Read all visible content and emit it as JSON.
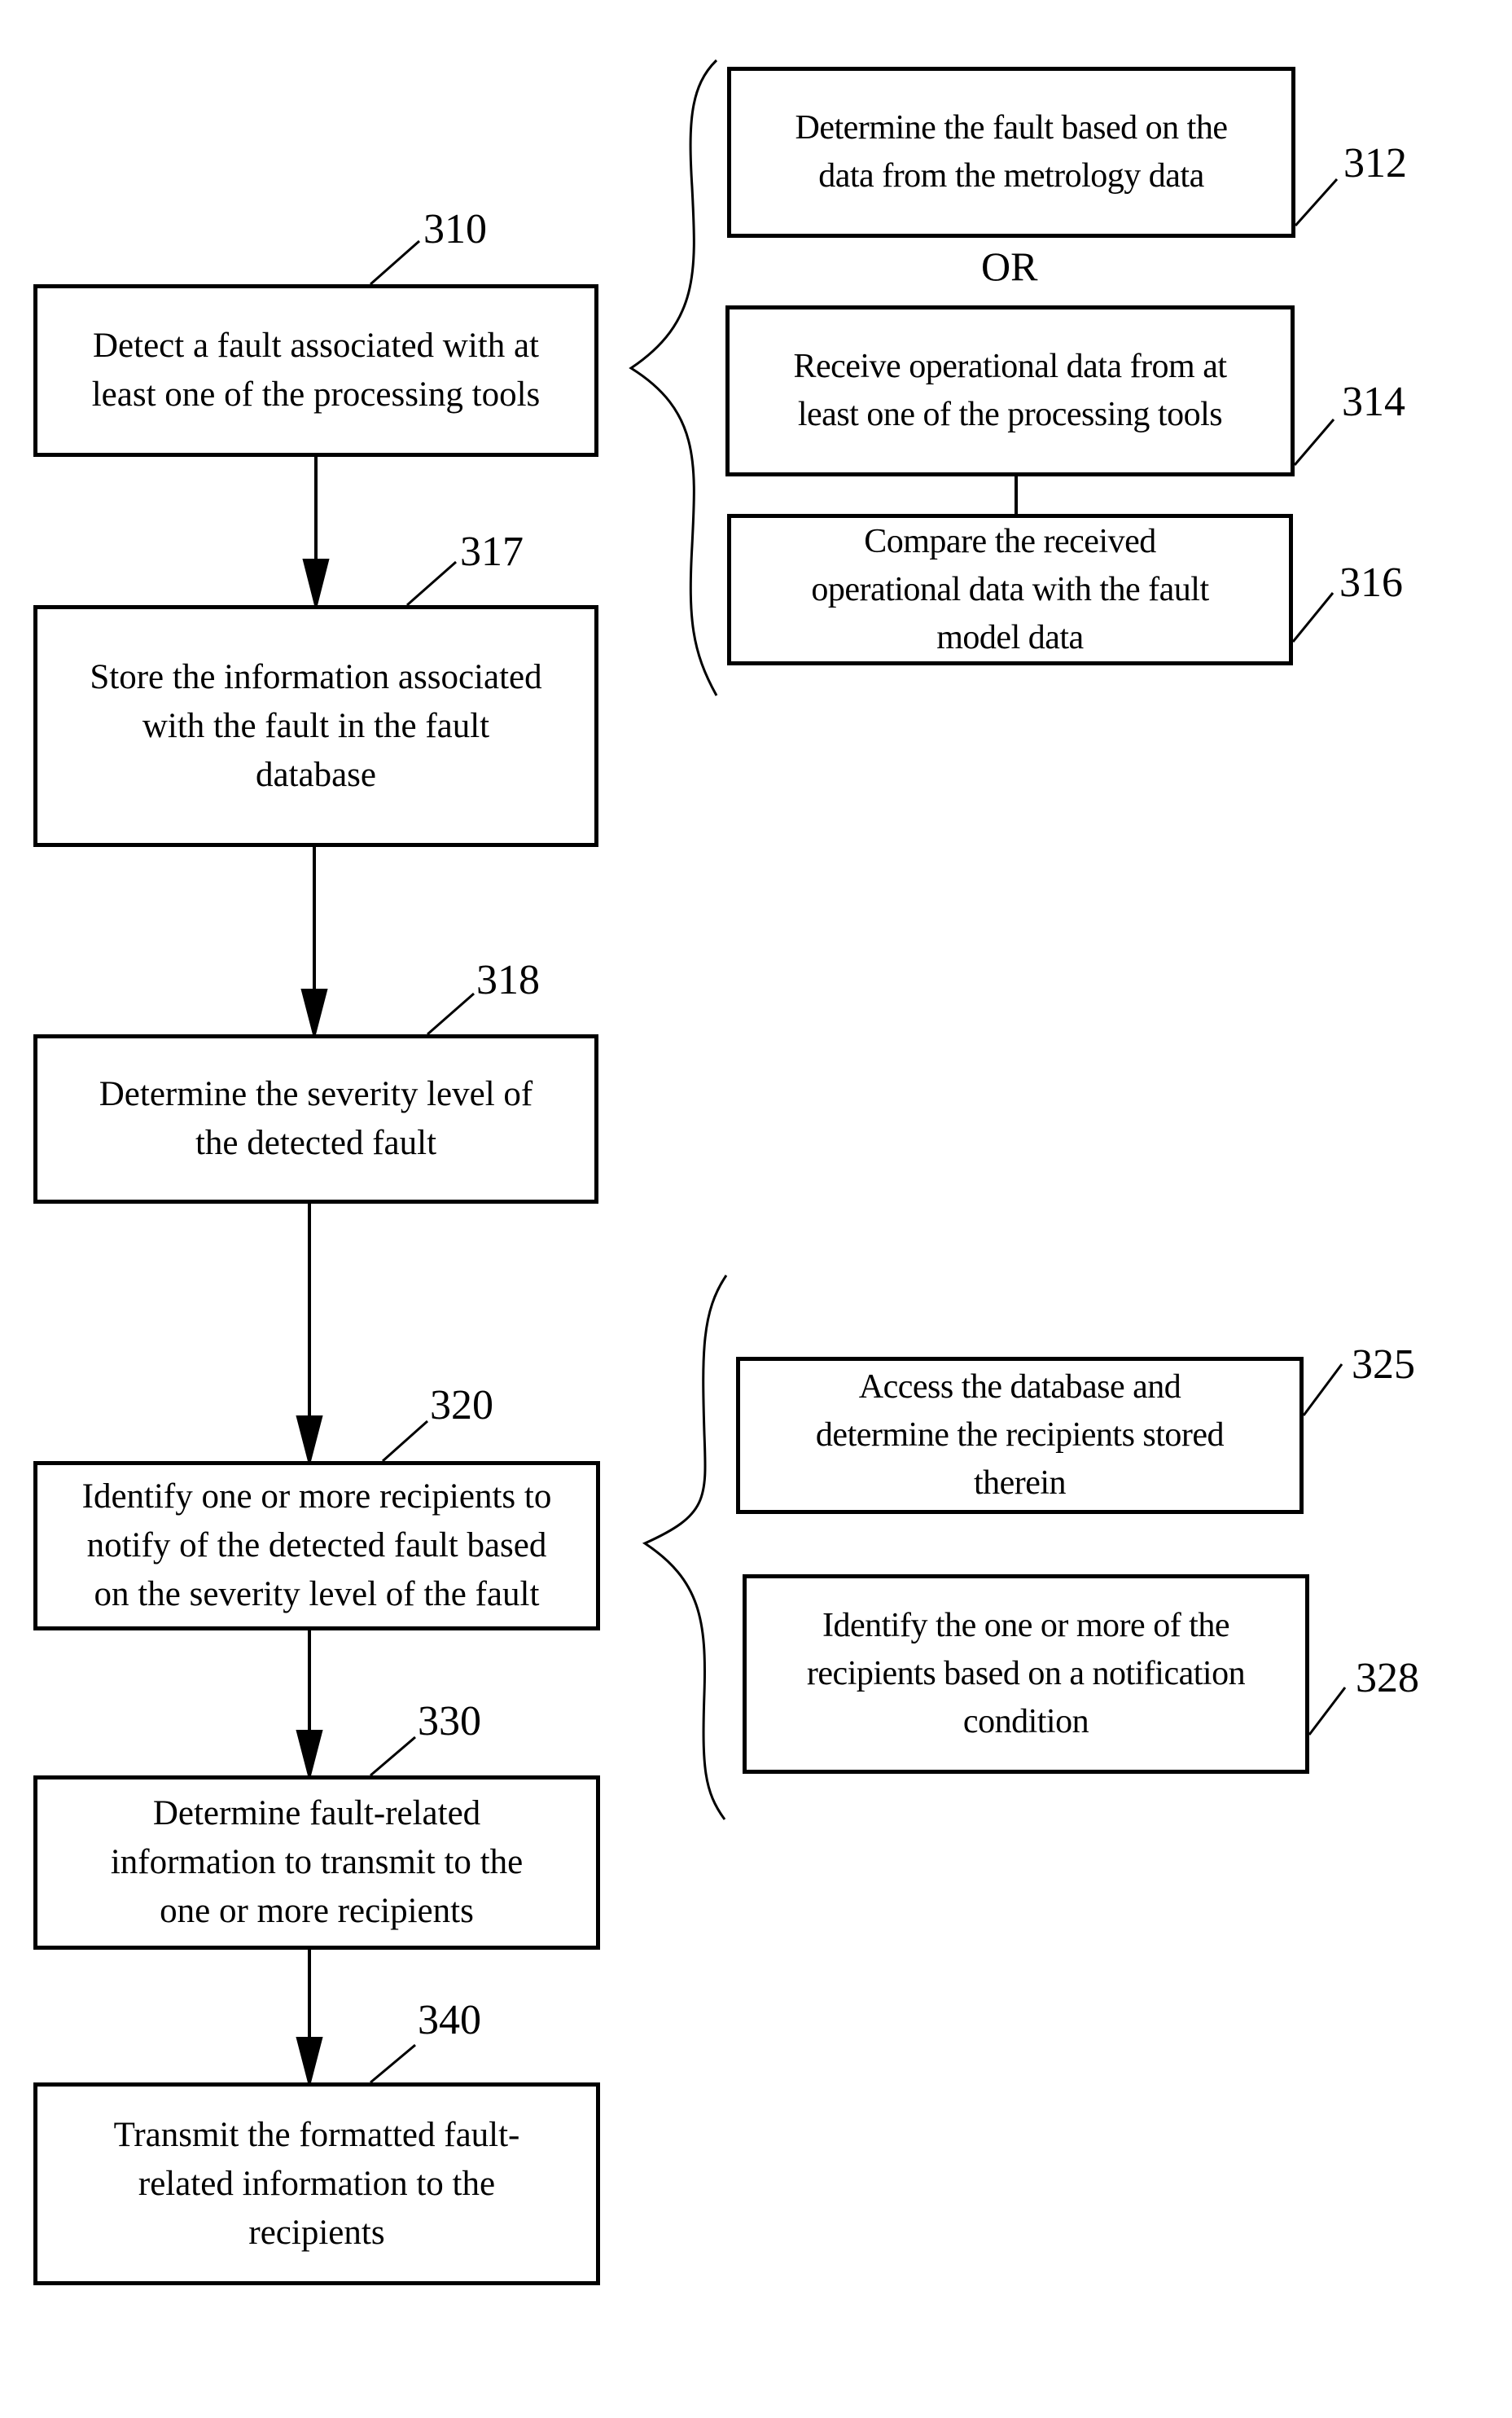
{
  "diagram": {
    "main_flow": [
      {
        "id": "310",
        "text_lines": [
          "Detect a fault associated with at",
          "least one of the processing tools"
        ]
      },
      {
        "id": "317",
        "text_lines": [
          "Store the information associated",
          "with the fault in the fault",
          "database"
        ]
      },
      {
        "id": "318",
        "text_lines": [
          "Determine the severity level of",
          "the detected fault"
        ]
      },
      {
        "id": "320",
        "text_lines": [
          "Identify one or more recipients to",
          "notify of the detected fault based",
          "on the severity level of the fault"
        ]
      },
      {
        "id": "330",
        "text_lines": [
          "Determine fault-related",
          "information to transmit to the",
          "one or more recipients"
        ]
      },
      {
        "id": "340",
        "text_lines": [
          "Transmit the formatted fault-",
          "related information to the",
          "recipients"
        ]
      }
    ],
    "detail_group_310": {
      "boxes": [
        {
          "id": "312",
          "text_lines": [
            "Determine the fault based on the",
            "data from the metrology data"
          ]
        },
        {
          "id": "314",
          "text_lines": [
            "Receive operational data from at",
            "least one of the processing tools"
          ]
        },
        {
          "id": "316",
          "text_lines": [
            "Compare the received",
            "operational data with the fault",
            "model data"
          ]
        }
      ],
      "separator": "OR"
    },
    "detail_group_320": {
      "boxes": [
        {
          "id": "325",
          "text_lines": [
            "Access the database and",
            "determine the recipients stored",
            "therein"
          ]
        },
        {
          "id": "328",
          "text_lines": [
            "Identify the one or more of the",
            "recipients based on a notification",
            "condition"
          ]
        }
      ]
    }
  }
}
